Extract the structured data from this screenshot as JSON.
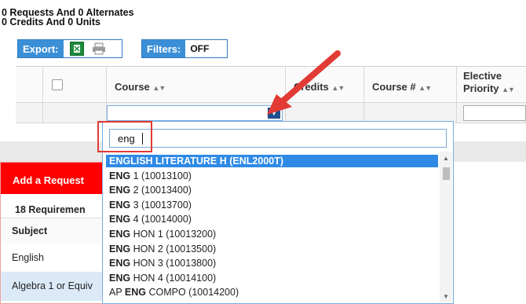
{
  "summary": {
    "line1": "0 Requests And 0 Alternates",
    "line2": "0 Credits And 0 Units"
  },
  "toolbar": {
    "export_label": "Export:",
    "filters_label": "Filters:",
    "filters_value": "OFF"
  },
  "grid": {
    "columns": [
      "Course",
      "Credits",
      "Course #",
      "Elective",
      "Priority"
    ]
  },
  "panel": {
    "title": "Add a Request",
    "requirements": "18 Requiremen",
    "subject_header": "Subject",
    "rows": [
      "English",
      "Algebra 1 or Equiv"
    ]
  },
  "dropdown": {
    "search_value": "eng",
    "options": [
      {
        "pre": "",
        "match": "ENG",
        "post": "LISH LITERATURE H (ENL2000T)",
        "selected": true
      },
      {
        "pre": "",
        "match": "ENG",
        "post": " 1 (10013100)",
        "selected": false
      },
      {
        "pre": "",
        "match": "ENG",
        "post": " 2 (10013400)",
        "selected": false
      },
      {
        "pre": "",
        "match": "ENG",
        "post": " 3 (10013700)",
        "selected": false
      },
      {
        "pre": "",
        "match": "ENG",
        "post": " 4 (10014000)",
        "selected": false
      },
      {
        "pre": "",
        "match": "ENG",
        "post": " HON 1 (10013200)",
        "selected": false
      },
      {
        "pre": "",
        "match": "ENG",
        "post": " HON 2 (10013500)",
        "selected": false
      },
      {
        "pre": "",
        "match": "ENG",
        "post": " HON 3 (10013800)",
        "selected": false
      },
      {
        "pre": "",
        "match": "ENG",
        "post": " HON 4 (10014100)",
        "selected": false
      },
      {
        "pre": "AP ",
        "match": "ENG",
        "post": " COMPO (10014200)",
        "selected": false
      }
    ]
  },
  "colors": {
    "accent": "#3b8fd6",
    "selected_option": "#2f8ae6",
    "panel_header": "#ff0000",
    "annotation": "#e23a35"
  }
}
